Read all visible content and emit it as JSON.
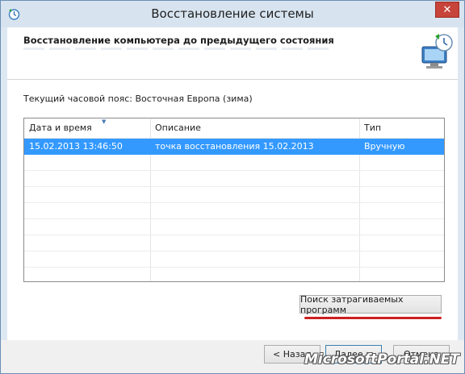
{
  "window": {
    "title": "Восстановление системы",
    "close_glyph": "✕"
  },
  "header": {
    "heading": "Восстановление компьютера до предыдущего состояния"
  },
  "timezone_text": "Текущий часовой пояс: Восточная Европа (зима)",
  "list": {
    "columns": [
      "Дата и время",
      "Описание",
      "Тип"
    ],
    "rows": [
      {
        "datetime": "15.02.2013 13:46:50",
        "description": "точка восстановления 15.02.2013",
        "type": "Вручную",
        "selected": true
      }
    ]
  },
  "buttons": {
    "scan": "Поиск затрагиваемых программ",
    "back": "< Назад",
    "next": "Далее >",
    "cancel": "Отмена"
  },
  "watermark": "MicrosoftPortal.NET",
  "colors": {
    "selection": "#3399ff",
    "highlight_line": "#cc1f1f"
  }
}
